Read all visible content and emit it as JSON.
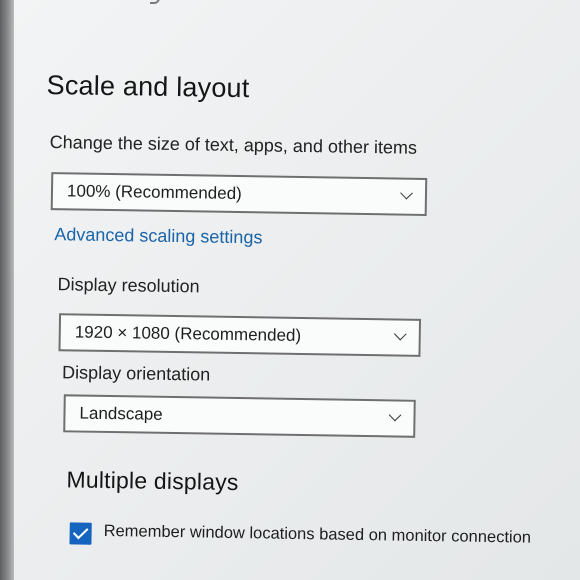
{
  "scale_layout": {
    "heading": "Scale and layout",
    "size_label": "Change the size of text, apps, and other items",
    "size_value": "100% (Recommended)",
    "advanced_link": "Advanced scaling settings",
    "resolution_label": "Display resolution",
    "resolution_value": "1920 × 1080 (Recommended)",
    "orientation_label": "Display orientation",
    "orientation_value": "Landscape"
  },
  "multiple_displays": {
    "heading": "Multiple displays",
    "remember_label": "Remember window locations based on monitor connection",
    "remember_checked": true
  },
  "colors": {
    "accent": "#1565c0",
    "link": "#1a64a8"
  }
}
